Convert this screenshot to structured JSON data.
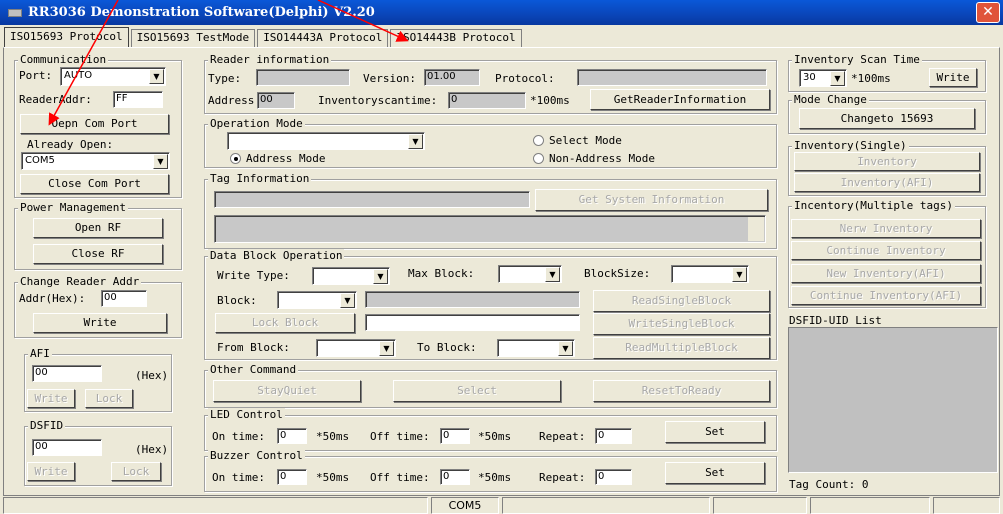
{
  "window": {
    "title": "RR3036 Demonstration Software(Delphi) V2.20",
    "close_glyph": "✕"
  },
  "tabs": [
    "ISO15693 Protocol",
    "ISO15693 TestMode",
    "ISO14443A Protocol",
    "ISO14443B Protocol"
  ],
  "communication": {
    "legend": "Communication",
    "port_label": "Port:",
    "port_value": "AUTO",
    "reader_addr_label": "ReaderAddr:",
    "reader_addr_value": "FF",
    "open_port_button": "Oepn Com Port",
    "already_open_label": "Already Open:",
    "already_open_value": "COM5",
    "close_port_button": "Close Com Port"
  },
  "power": {
    "legend": "Power Management",
    "open_rf": "Open RF",
    "close_rf": "Close RF"
  },
  "change_addr": {
    "legend": "Change Reader Addr",
    "addr_label": "Addr(Hex):",
    "addr_value": "00",
    "write": "Write"
  },
  "afi": {
    "legend": "AFI",
    "value": "00",
    "hex": "(Hex)",
    "write": "Write",
    "lock": "Lock"
  },
  "dsfid": {
    "legend": "DSFID",
    "value": "00",
    "hex": "(Hex)",
    "write": "Write",
    "lock": "Lock"
  },
  "reader_info": {
    "legend": "Reader information",
    "type_label": "Type:",
    "type_value": "",
    "version_label": "Version:",
    "version_value": "01.00",
    "protocol_label": "Protocol:",
    "protocol_value": "",
    "address_label": "Address:",
    "address_value": "00",
    "inv_time_label": "Inventoryscantime:",
    "inv_time_value": "0",
    "inv_unit": "*100ms",
    "get_button": "GetReaderInformation"
  },
  "operation_mode": {
    "legend": "Operation Mode",
    "mode_value": "",
    "select_mode": "Select Mode",
    "address_mode": "Address Mode",
    "non_address_mode": "Non-Address Mode"
  },
  "tag_info": {
    "legend": "Tag Information",
    "get_button": "Get System Information"
  },
  "data_block": {
    "legend": "Data Block Operation",
    "write_type_label": "Write Type:",
    "max_block_label": "Max Block:",
    "block_size_label": "BlockSize:",
    "block_label": "Block:",
    "read_single": "ReadSingleBlock",
    "lock_block": "Lock Block",
    "write_single": "WriteSingleBlock",
    "from_block_label": "From Block:",
    "to_block_label": "To Block:",
    "read_multiple": "ReadMultipleBlock"
  },
  "other_command": {
    "legend": "Other Command",
    "stay_quiet": "StayQuiet",
    "select": "Select",
    "reset": "ResetToReady"
  },
  "led": {
    "legend": "LED Control",
    "on_time_label": "On time:",
    "on_time_value": "0",
    "on_unit": "*50ms",
    "off_time_label": "Off time:",
    "off_time_value": "0",
    "off_unit": "*50ms",
    "repeat_label": "Repeat:",
    "repeat_value": "0",
    "set": "Set"
  },
  "buzzer": {
    "legend": "Buzzer Control",
    "on_time_label": "On time:",
    "on_time_value": "0",
    "on_unit": "*50ms",
    "off_time_label": "Off time:",
    "off_time_value": "0",
    "off_unit": "*50ms",
    "repeat_label": "Repeat:",
    "repeat_value": "0",
    "set": "Set"
  },
  "inventory_scan": {
    "legend": "Inventory Scan Time",
    "value": "30",
    "unit": "*100ms",
    "write": "Write"
  },
  "mode_change": {
    "legend": "Mode Change",
    "button": "Changeto 15693"
  },
  "inventory_single": {
    "legend": "Inventory(Single)",
    "inventory": "Inventory",
    "inventory_afi": "Inventory(AFI)"
  },
  "inventory_multi": {
    "legend": "Incentory(Multiple tags)",
    "new": "Nerw Inventory",
    "continue": "Continue Inventory",
    "new_afi": "New Inventory(AFI)",
    "continue_afi": "Continue Inventory(AFI)"
  },
  "dsfid_list": {
    "label": "DSFID-UID List",
    "tag_count": "Tag Count: 0"
  },
  "statusbar": {
    "port": "COM5"
  },
  "colors": {
    "annotation_arrow": "#ff0000",
    "title_bar": "#0a45b8"
  }
}
